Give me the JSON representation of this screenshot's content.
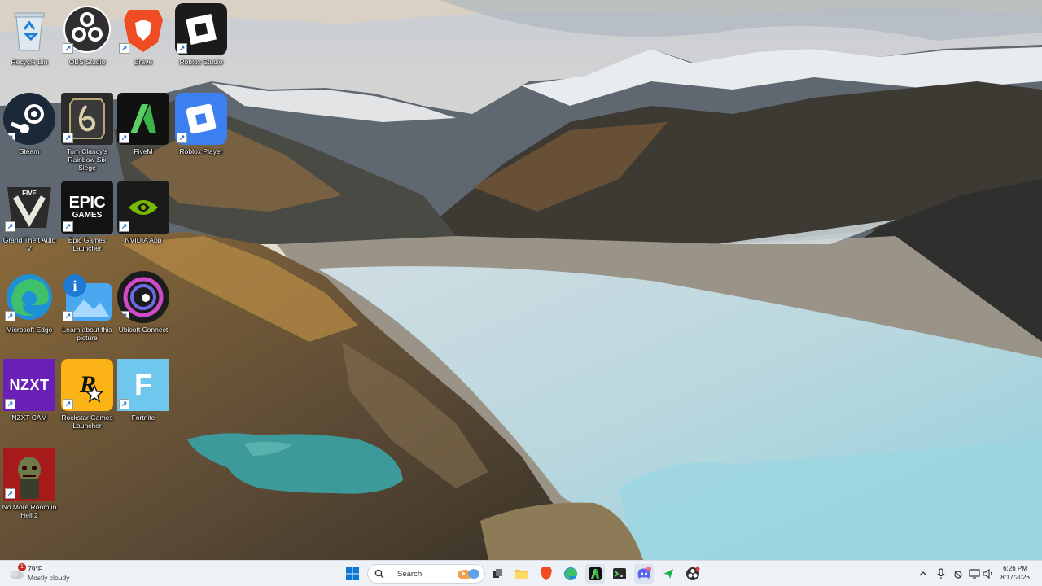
{
  "desktop": {
    "icons": [
      {
        "label": "Recycle Bin",
        "icon": "recycle-bin-icon"
      },
      {
        "label": "OBS Studio",
        "icon": "obs-studio-icon"
      },
      {
        "label": "Brave",
        "icon": "brave-icon"
      },
      {
        "label": "Roblox Studio",
        "icon": "roblox-studio-icon"
      },
      {
        "label": "Steam",
        "icon": "steam-icon"
      },
      {
        "label": "Tom Clancy's Rainbow Six Siege",
        "icon": "rainbow-six-siege-icon"
      },
      {
        "label": "FiveM",
        "icon": "fivem-icon"
      },
      {
        "label": "Roblox Player",
        "icon": "roblox-player-icon"
      },
      {
        "label": "Grand Theft Auto V",
        "icon": "gta-v-icon"
      },
      {
        "label": "Epic Games Launcher",
        "icon": "epic-games-icon",
        "tile_text_1": "EPIC",
        "tile_text_2": "GAMES"
      },
      {
        "label": "NVIDIA App",
        "icon": "nvidia-icon"
      },
      {
        "label": "Microsoft Edge",
        "icon": "edge-icon"
      },
      {
        "label": "Learn about this picture",
        "icon": "learn-picture-icon"
      },
      {
        "label": "Ubisoft Connect",
        "icon": "ubisoft-icon"
      },
      {
        "label": "NZXT CAM",
        "icon": "nzxt-icon",
        "tile_text": "NZXT"
      },
      {
        "label": "Rockstar Games Launcher",
        "icon": "rockstar-icon"
      },
      {
        "label": "Fortnite",
        "icon": "fortnite-icon",
        "tile_text": "F"
      },
      {
        "label": "No More Room in Hell 2",
        "icon": "no-more-room-in-hell-2-icon"
      }
    ]
  },
  "taskbar": {
    "weather": {
      "temp": "79°F",
      "condition": "Mostly cloudy",
      "badge": "1"
    },
    "search_placeholder": "Search",
    "clock": {
      "time": "6:26 PM",
      "date": "8/17/2026"
    },
    "pinned": [
      "start-icon",
      "search-icon",
      "task-view-icon",
      "file-explorer-icon",
      "brave-icon",
      "edge-icon",
      "fivem-icon",
      "terminal-icon",
      "discord-icon",
      "app-icon",
      "obs-icon"
    ],
    "tray": [
      "chevron-up-icon",
      "microphone-icon",
      "network-icon",
      "display-icon",
      "speaker-icon"
    ],
    "colors": {
      "bar": "#eef1f6",
      "accent": "#0067c0"
    }
  }
}
